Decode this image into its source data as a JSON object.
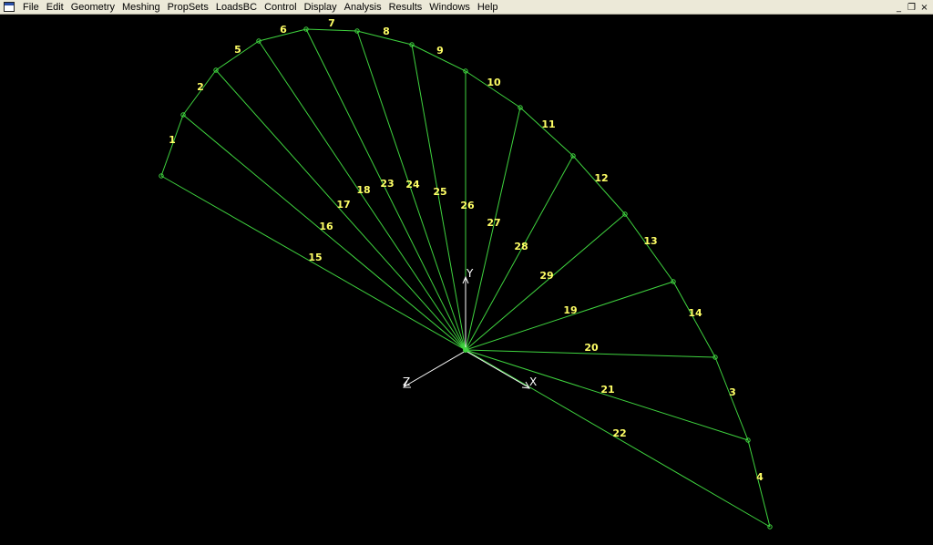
{
  "menubar": {
    "app_icon": "window-app-icon",
    "items": [
      {
        "label": "File"
      },
      {
        "label": "Edit"
      },
      {
        "label": "Geometry"
      },
      {
        "label": "Meshing"
      },
      {
        "label": "PropSets"
      },
      {
        "label": "LoadsBC"
      },
      {
        "label": "Control"
      },
      {
        "label": "Display"
      },
      {
        "label": "Analysis"
      },
      {
        "label": "Results"
      },
      {
        "label": "Windows"
      },
      {
        "label": "Help"
      }
    ],
    "window_controls": {
      "minimize": "_",
      "restore": "❐",
      "close": "×"
    }
  },
  "model": {
    "line_color": "#3fd43f",
    "label_color": "#ffff66",
    "axis_color": "#ffffff",
    "center_node": "center-node",
    "outer_nodes": [
      "outer-node-1",
      "outer-node-2",
      "outer-node-3",
      "outer-node-4",
      "outer-node-5",
      "outer-node-6",
      "outer-node-7",
      "outer-node-8",
      "outer-node-9",
      "outer-node-10",
      "outer-node-11",
      "outer-node-12",
      "outer-node-13",
      "outer-node-14",
      "outer-node-15",
      "outer-node-16",
      "outer-node-17"
    ],
    "arc_line_labels": [
      "1",
      "2",
      "5",
      "6",
      "7",
      "8",
      "9",
      "10",
      "11",
      "12",
      "13",
      "14",
      "3",
      "4"
    ],
    "radial_line_labels": [
      "15",
      "16",
      "17",
      "18",
      "23",
      "24",
      "25",
      "26",
      "27",
      "28",
      "29",
      "19",
      "20",
      "21",
      "22"
    ],
    "axes": {
      "x": "X",
      "y": "Y",
      "z": "Z"
    }
  }
}
